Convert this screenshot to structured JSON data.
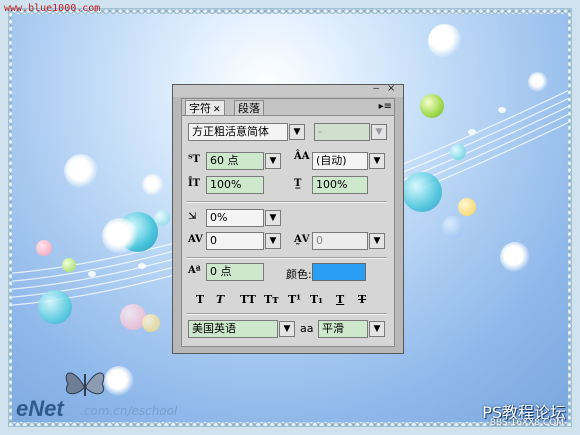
{
  "watermark_top": "www.blue1000.com",
  "panel": {
    "tabs": [
      {
        "label": "字符",
        "active": true
      },
      {
        "label": "段落",
        "active": false
      }
    ],
    "font_family": "方正粗活意简体",
    "font_style": "-",
    "font_size": "60 点",
    "leading": "(自动)",
    "vertical_scale": "100%",
    "horizontal_scale": "100%",
    "tsume": "0%",
    "kerning": "0",
    "tracking": "0",
    "baseline_shift": "0 点",
    "color_label": "颜色:",
    "color_value": "#2a9df4",
    "style_buttons": [
      "T",
      "T",
      "TT",
      "Tт",
      "T¹",
      "T₁",
      "T",
      "T"
    ],
    "language": "美国英语",
    "antialias_icon": "aa",
    "antialias": "平滑"
  },
  "logo": {
    "main": "eNet",
    "sub": ".com.cn/eschool"
  },
  "watermark_right": {
    "line1": "PS教程论坛",
    "line2": "BBS.16XX8.COM"
  }
}
